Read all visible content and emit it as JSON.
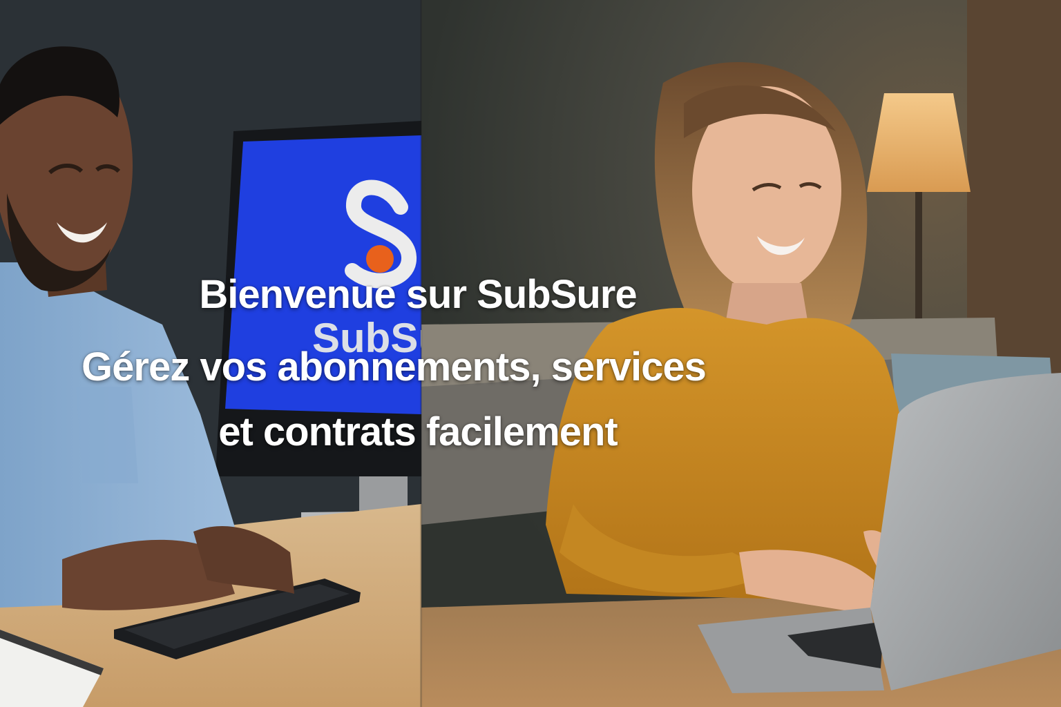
{
  "hero": {
    "title": "Bienvenue sur SubSure",
    "subtitle_line1": "Gérez vos abonnements, services",
    "subtitle_line2": "et contrats facilement"
  },
  "screen_logo": {
    "wordmark": "SubSu",
    "background_color": "#1f3fe0",
    "dot_color": "#e8611c"
  },
  "panels": [
    {
      "subject": "man-at-desktop-computer",
      "shirt_color": "#8fb1d4"
    },
    {
      "subject": "woman-at-laptop",
      "sweater_color": "#c9891f"
    }
  ]
}
